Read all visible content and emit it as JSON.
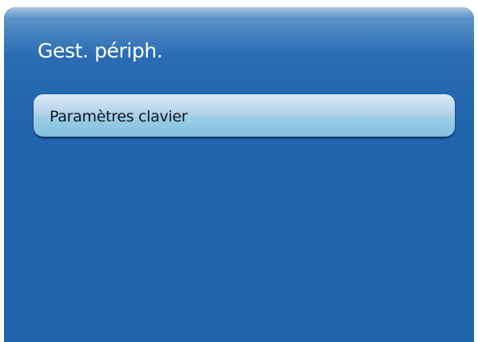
{
  "menu": {
    "title": "Gest. périph.",
    "items": [
      {
        "label": "Paramètres clavier",
        "selected": true
      }
    ]
  },
  "colors": {
    "background": "#1f64ad",
    "highlight": "#a7cbe7",
    "text": "#ffffff",
    "item_text": "#0e1720"
  }
}
